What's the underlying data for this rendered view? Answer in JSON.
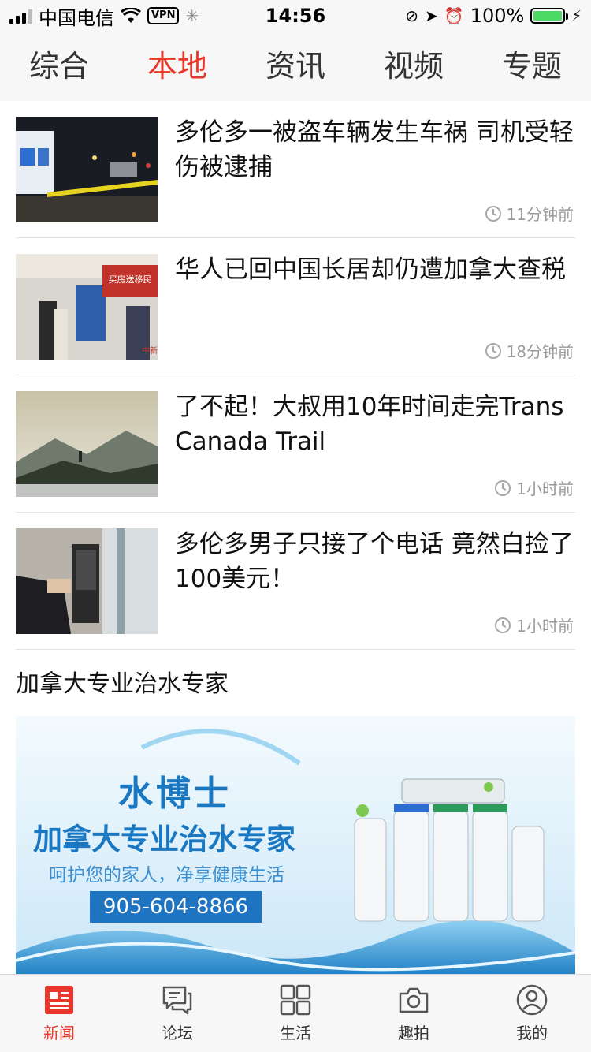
{
  "status_bar": {
    "carrier": "中国电信",
    "vpn": "VPN",
    "time": "14:56",
    "battery": "100%"
  },
  "tabs": [
    {
      "label": "综合",
      "active": false
    },
    {
      "label": "本地",
      "active": true
    },
    {
      "label": "资讯",
      "active": false
    },
    {
      "label": "视频",
      "active": false
    },
    {
      "label": "专题",
      "active": false
    }
  ],
  "news": [
    {
      "title": "多伦多一被盗车辆发生车祸 司机受轻伤被逮捕",
      "time": "11分钟前"
    },
    {
      "title": "华人已回中国长居却仍遭加拿大查税",
      "time": "18分钟前"
    },
    {
      "title": "了不起！大叔用10年时间走完Trans Canada Trail",
      "time": "1小时前"
    },
    {
      "title": "多伦多男子只接了个电话 竟然白捡了100美元！",
      "time": "1小时前"
    }
  ],
  "section": {
    "label": "加拿大专业治水专家"
  },
  "ad": {
    "brand": "水博士",
    "headline": "加拿大专业治水专家",
    "slogan": "呵护您的家人，净享健康生活",
    "phone": "905-604-8866",
    "photo_watermark": "中新网"
  },
  "bottom_nav": [
    {
      "label": "新闻",
      "icon": "news-icon",
      "active": true
    },
    {
      "label": "论坛",
      "icon": "chat-icon",
      "active": false
    },
    {
      "label": "生活",
      "icon": "grid-icon",
      "active": false
    },
    {
      "label": "趣拍",
      "icon": "camera-icon",
      "active": false
    },
    {
      "label": "我的",
      "icon": "profile-icon",
      "active": false
    }
  ],
  "colors": {
    "accent": "#e8362a",
    "meta_gray": "#9a9a9a",
    "bar_bg": "#f7f7f7"
  }
}
